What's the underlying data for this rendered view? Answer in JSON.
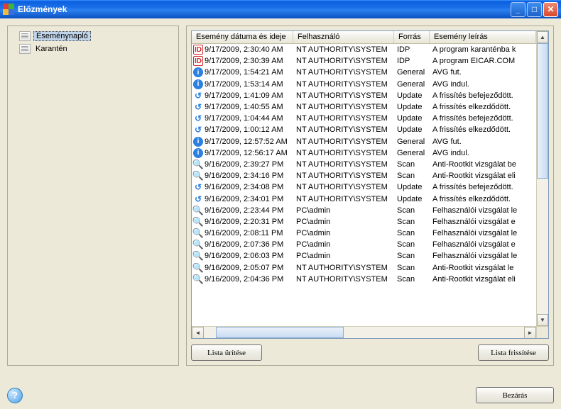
{
  "window": {
    "title": "Előzmények"
  },
  "tree": {
    "items": [
      {
        "label": "Eseménynapló",
        "selected": true
      },
      {
        "label": "Karantén",
        "selected": false
      }
    ]
  },
  "columns": {
    "date": "Esemény dátuma és ideje",
    "user": "Felhasználó",
    "src": "Forrás",
    "desc": "Esemény leírás"
  },
  "rows": [
    {
      "icon": "idp",
      "date": "9/17/2009, 2:30:40 AM",
      "user": "NT AUTHORITY\\SYSTEM",
      "src": "IDP",
      "desc": "A program karanténba k"
    },
    {
      "icon": "idp",
      "date": "9/17/2009, 2:30:39 AM",
      "user": "NT AUTHORITY\\SYSTEM",
      "src": "IDP",
      "desc": "A program EICAR.COM"
    },
    {
      "icon": "info",
      "date": "9/17/2009, 1:54:21 AM",
      "user": "NT AUTHORITY\\SYSTEM",
      "src": "General",
      "desc": "AVG fut."
    },
    {
      "icon": "info",
      "date": "9/17/2009, 1:53:14 AM",
      "user": "NT AUTHORITY\\SYSTEM",
      "src": "General",
      "desc": "AVG indul."
    },
    {
      "icon": "update",
      "date": "9/17/2009, 1:41:09 AM",
      "user": "NT AUTHORITY\\SYSTEM",
      "src": "Update",
      "desc": "A frissítés befejeződött."
    },
    {
      "icon": "update",
      "date": "9/17/2009, 1:40:55 AM",
      "user": "NT AUTHORITY\\SYSTEM",
      "src": "Update",
      "desc": "A frissítés elkezdődött."
    },
    {
      "icon": "update",
      "date": "9/17/2009, 1:04:44 AM",
      "user": "NT AUTHORITY\\SYSTEM",
      "src": "Update",
      "desc": "A frissítés befejeződött."
    },
    {
      "icon": "update",
      "date": "9/17/2009, 1:00:12 AM",
      "user": "NT AUTHORITY\\SYSTEM",
      "src": "Update",
      "desc": "A frissítés elkezdődött."
    },
    {
      "icon": "info",
      "date": "9/17/2009, 12:57:52 AM",
      "user": "NT AUTHORITY\\SYSTEM",
      "src": "General",
      "desc": "AVG fut."
    },
    {
      "icon": "info",
      "date": "9/17/2009, 12:56:17 AM",
      "user": "NT AUTHORITY\\SYSTEM",
      "src": "General",
      "desc": "AVG indul."
    },
    {
      "icon": "scan",
      "date": "9/16/2009, 2:39:27 PM",
      "user": "NT AUTHORITY\\SYSTEM",
      "src": "Scan",
      "desc": "Anti-Rootkit vizsgálat be"
    },
    {
      "icon": "scan",
      "date": "9/16/2009, 2:34:16 PM",
      "user": "NT AUTHORITY\\SYSTEM",
      "src": "Scan",
      "desc": "Anti-Rootkit vizsgálat eli"
    },
    {
      "icon": "update",
      "date": "9/16/2009, 2:34:08 PM",
      "user": "NT AUTHORITY\\SYSTEM",
      "src": "Update",
      "desc": "A frissítés befejeződött."
    },
    {
      "icon": "update",
      "date": "9/16/2009, 2:34:01 PM",
      "user": "NT AUTHORITY\\SYSTEM",
      "src": "Update",
      "desc": "A frissítés elkezdődött."
    },
    {
      "icon": "scan",
      "date": "9/16/2009, 2:23:44 PM",
      "user": "PC\\admin",
      "src": "Scan",
      "desc": "Felhasználói vizsgálat le"
    },
    {
      "icon": "scan",
      "date": "9/16/2009, 2:20:31 PM",
      "user": "PC\\admin",
      "src": "Scan",
      "desc": "Felhasználói vizsgálat e"
    },
    {
      "icon": "scan",
      "date": "9/16/2009, 2:08:11 PM",
      "user": "PC\\admin",
      "src": "Scan",
      "desc": "Felhasználói vizsgálat le"
    },
    {
      "icon": "scan",
      "date": "9/16/2009, 2:07:36 PM",
      "user": "PC\\admin",
      "src": "Scan",
      "desc": "Felhasználói vizsgálat e"
    },
    {
      "icon": "scan",
      "date": "9/16/2009, 2:06:03 PM",
      "user": "PC\\admin",
      "src": "Scan",
      "desc": "Felhasználói vizsgálat le"
    },
    {
      "icon": "scan",
      "date": "9/16/2009, 2:05:07 PM",
      "user": "NT AUTHORITY\\SYSTEM",
      "src": "Scan",
      "desc": "Anti-Rootkit vizsgálat le"
    },
    {
      "icon": "scan",
      "date": "9/16/2009, 2:04:36 PM",
      "user": "NT AUTHORITY\\SYSTEM",
      "src": "Scan",
      "desc": "Anti-Rootkit vizsgálat eli"
    }
  ],
  "buttons": {
    "empty": "Lista ürítése",
    "refresh": "Lista frissítése",
    "close": "Bezárás"
  }
}
